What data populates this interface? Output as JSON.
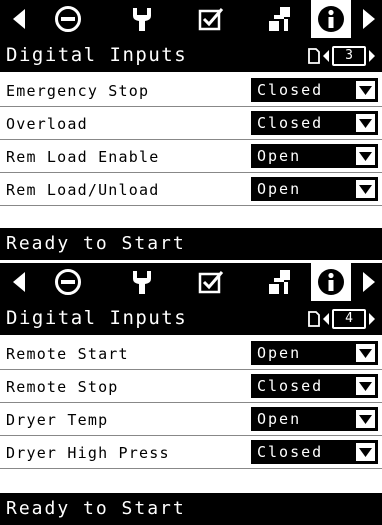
{
  "toolbar": {
    "icons": [
      "left-arrow-icon",
      "stop-circle-icon",
      "wrench-icon",
      "checklist-icon",
      "network-icon",
      "info-icon",
      "right-arrow-icon"
    ],
    "selected": "info-icon"
  },
  "screens": [
    {
      "title": "Digital Inputs",
      "page": "3",
      "rows": [
        {
          "label": "Emergency Stop",
          "value": "Closed"
        },
        {
          "label": "Overload",
          "value": "Closed"
        },
        {
          "label": "Rem Load Enable",
          "value": "Open"
        },
        {
          "label": "Rem Load/Unload",
          "value": "Open"
        }
      ],
      "status": "Ready to Start"
    },
    {
      "title": "Digital Inputs",
      "page": "4",
      "rows": [
        {
          "label": "Remote Start",
          "value": "Open"
        },
        {
          "label": "Remote Stop",
          "value": "Closed"
        },
        {
          "label": "Dryer Temp",
          "value": "Open"
        },
        {
          "label": "Dryer High Press",
          "value": "Closed"
        }
      ],
      "status": "Ready to Start"
    }
  ]
}
